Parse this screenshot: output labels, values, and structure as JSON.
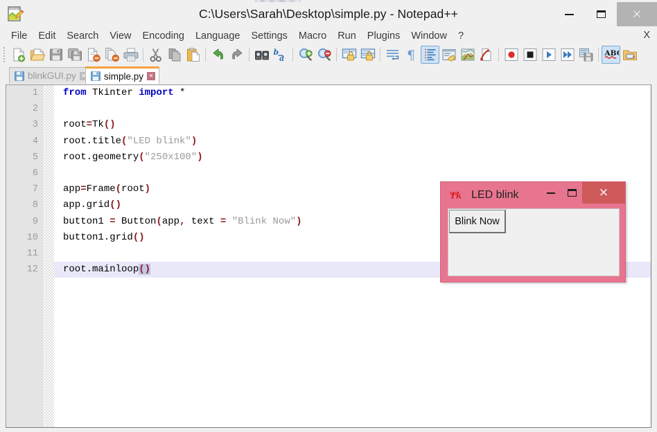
{
  "window": {
    "title": "C:\\Users\\Sarah\\Desktop\\simple.py - Notepad++",
    "app_icon": "notepad-pencil-icon",
    "minimize_label": "",
    "maximize_label": "",
    "close_label": "×",
    "close_button_color": "#b3b3b3",
    "chrome_background": "#f0f0f0"
  },
  "menubar": {
    "items": [
      {
        "label": "File"
      },
      {
        "label": "Edit"
      },
      {
        "label": "Search"
      },
      {
        "label": "View"
      },
      {
        "label": "Encoding"
      },
      {
        "label": "Language"
      },
      {
        "label": "Settings"
      },
      {
        "label": "Macro"
      },
      {
        "label": "Run"
      },
      {
        "label": "Plugins"
      },
      {
        "label": "Window"
      },
      {
        "label": "?"
      }
    ],
    "close_document_label": "X"
  },
  "toolbar": {
    "buttons": [
      {
        "name": "new-file-icon",
        "active": false
      },
      {
        "name": "open-file-icon",
        "active": false
      },
      {
        "name": "save-icon",
        "active": false
      },
      {
        "name": "save-all-icon",
        "active": false
      },
      {
        "name": "close-file-icon",
        "active": false
      },
      {
        "name": "close-all-files-icon",
        "active": false
      },
      {
        "name": "print-icon",
        "active": false
      },
      {
        "name": "separator",
        "active": false
      },
      {
        "name": "cut-icon",
        "active": false
      },
      {
        "name": "copy-icon",
        "active": false
      },
      {
        "name": "paste-icon",
        "active": false
      },
      {
        "name": "separator",
        "active": false
      },
      {
        "name": "undo-icon",
        "active": false
      },
      {
        "name": "redo-icon",
        "active": false
      },
      {
        "name": "separator",
        "active": false
      },
      {
        "name": "find-icon",
        "active": false
      },
      {
        "name": "replace-icon",
        "active": false
      },
      {
        "name": "separator",
        "active": false
      },
      {
        "name": "zoom-in-icon",
        "active": false
      },
      {
        "name": "zoom-out-icon",
        "active": false
      },
      {
        "name": "separator",
        "active": false
      },
      {
        "name": "sync-vertical-scroll-icon",
        "active": false
      },
      {
        "name": "sync-horizontal-scroll-icon",
        "active": false
      },
      {
        "name": "separator",
        "active": false
      },
      {
        "name": "word-wrap-icon",
        "active": false
      },
      {
        "name": "show-all-characters-icon",
        "active": false
      },
      {
        "name": "show-indent-guide-icon",
        "active": true
      },
      {
        "name": "user-defined-dialog-icon",
        "active": false
      },
      {
        "name": "document-map-icon",
        "active": false
      },
      {
        "name": "function-list-icon",
        "active": false
      },
      {
        "name": "separator",
        "active": false
      },
      {
        "name": "start-record-macro-icon",
        "active": false
      },
      {
        "name": "stop-record-macro-icon",
        "active": false
      },
      {
        "name": "play-macro-icon",
        "active": false
      },
      {
        "name": "run-macro-multiple-icon",
        "active": false
      },
      {
        "name": "save-macro-icon",
        "active": false
      },
      {
        "name": "separator",
        "active": false
      },
      {
        "name": "spell-check-icon",
        "active": true
      },
      {
        "name": "file-browser-icon",
        "active": false
      }
    ]
  },
  "tabs": [
    {
      "label": "blinkGUI.py",
      "active": false,
      "icon": "floppy-disk-icon",
      "close": "×"
    },
    {
      "label": "simple.py",
      "active": true,
      "icon": "floppy-disk-icon",
      "close": "×"
    }
  ],
  "editor": {
    "active_line": 12,
    "accent_active_tab": "#f5a13c",
    "current_line_highlight": "#e8e8f8",
    "lines": [
      {
        "num": "1",
        "tokens": [
          {
            "t": "from",
            "c": "kw"
          },
          {
            "t": " Tkinter ",
            "c": "plain"
          },
          {
            "t": "import",
            "c": "kw"
          },
          {
            "t": " *",
            "c": "plain"
          }
        ]
      },
      {
        "num": "2",
        "tokens": []
      },
      {
        "num": "3",
        "tokens": [
          {
            "t": "root",
            "c": "plain"
          },
          {
            "t": "=",
            "c": "op"
          },
          {
            "t": "Tk",
            "c": "plain"
          },
          {
            "t": "()",
            "c": "op"
          }
        ]
      },
      {
        "num": "4",
        "tokens": [
          {
            "t": "root.title",
            "c": "plain"
          },
          {
            "t": "(",
            "c": "op"
          },
          {
            "t": "\"LED blink\"",
            "c": "str"
          },
          {
            "t": ")",
            "c": "op"
          }
        ]
      },
      {
        "num": "5",
        "tokens": [
          {
            "t": "root.geometry",
            "c": "plain"
          },
          {
            "t": "(",
            "c": "op"
          },
          {
            "t": "\"250x100\"",
            "c": "str"
          },
          {
            "t": ")",
            "c": "op"
          }
        ]
      },
      {
        "num": "6",
        "tokens": []
      },
      {
        "num": "7",
        "tokens": [
          {
            "t": "app",
            "c": "plain"
          },
          {
            "t": "=",
            "c": "op"
          },
          {
            "t": "Frame",
            "c": "plain"
          },
          {
            "t": "(",
            "c": "op"
          },
          {
            "t": "root",
            "c": "plain"
          },
          {
            "t": ")",
            "c": "op"
          }
        ]
      },
      {
        "num": "8",
        "tokens": [
          {
            "t": "app.grid",
            "c": "plain"
          },
          {
            "t": "()",
            "c": "op"
          }
        ]
      },
      {
        "num": "9",
        "tokens": [
          {
            "t": "button1 ",
            "c": "plain"
          },
          {
            "t": "=",
            "c": "op"
          },
          {
            "t": " Button",
            "c": "plain"
          },
          {
            "t": "(",
            "c": "op"
          },
          {
            "t": "app",
            "c": "plain"
          },
          {
            "t": ",",
            "c": "op"
          },
          {
            "t": " text ",
            "c": "plain"
          },
          {
            "t": "=",
            "c": "op"
          },
          {
            "t": " ",
            "c": "plain"
          },
          {
            "t": "\"Blink Now\"",
            "c": "str"
          },
          {
            "t": ")",
            "c": "op"
          }
        ]
      },
      {
        "num": "10",
        "tokens": [
          {
            "t": "button1.grid",
            "c": "plain"
          },
          {
            "t": "()",
            "c": "op"
          }
        ]
      },
      {
        "num": "11",
        "tokens": []
      },
      {
        "num": "12",
        "tokens": [
          {
            "t": "root.mainloop",
            "c": "plain"
          },
          {
            "t": "()",
            "c": "op",
            "sel": true
          }
        ]
      }
    ]
  },
  "tk_window": {
    "title": "LED blink",
    "icon": "tk-feather-icon",
    "titlebar_color": "#e8758f",
    "close_button_color": "#ce5a5a",
    "client_color": "#f0f0f0",
    "minimize_label": "",
    "maximize_label": "",
    "close_label": "×",
    "button_label": "Blink Now"
  }
}
